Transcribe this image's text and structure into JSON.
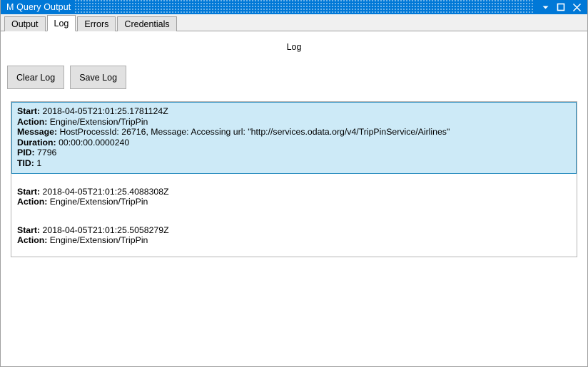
{
  "window": {
    "title": "M Query Output",
    "controls": [
      {
        "name": "minimize",
        "glyph": "chevron-down"
      },
      {
        "name": "maximize",
        "glyph": "square"
      },
      {
        "name": "close",
        "glyph": "x"
      }
    ],
    "titlebar_color": "#0078d7"
  },
  "tabs": [
    {
      "label": "Output",
      "active": false
    },
    {
      "label": "Log",
      "active": true
    },
    {
      "label": "Errors",
      "active": false
    },
    {
      "label": "Credentials",
      "active": false
    }
  ],
  "main": {
    "heading": "Log",
    "buttons": {
      "clear_log": "Clear Log",
      "save_log": "Save Log"
    },
    "selection_color": "#cdeaf7",
    "selection_border_color": "#2e8fc0"
  },
  "log_entries": [
    {
      "selected": true,
      "fields": [
        {
          "label": "Start:",
          "value": "2018-04-05T21:01:25.1781124Z"
        },
        {
          "label": "Action:",
          "value": "Engine/Extension/TripPin"
        },
        {
          "label": "Message:",
          "value": "HostProcessId: 26716, Message: Accessing url: \"http://services.odata.org/v4/TripPinService/Airlines\""
        },
        {
          "label": "Duration:",
          "value": "00:00:00.0000240"
        },
        {
          "label": "PID:",
          "value": "7796"
        },
        {
          "label": "TID:",
          "value": "1"
        }
      ]
    },
    {
      "selected": false,
      "fields": [
        {
          "label": "Start:",
          "value": "2018-04-05T21:01:25.4088308Z"
        },
        {
          "label": "Action:",
          "value": "Engine/Extension/TripPin"
        }
      ]
    },
    {
      "selected": false,
      "fields": [
        {
          "label": "Start:",
          "value": "2018-04-05T21:01:25.5058279Z"
        },
        {
          "label": "Action:",
          "value": "Engine/Extension/TripPin"
        }
      ]
    }
  ]
}
